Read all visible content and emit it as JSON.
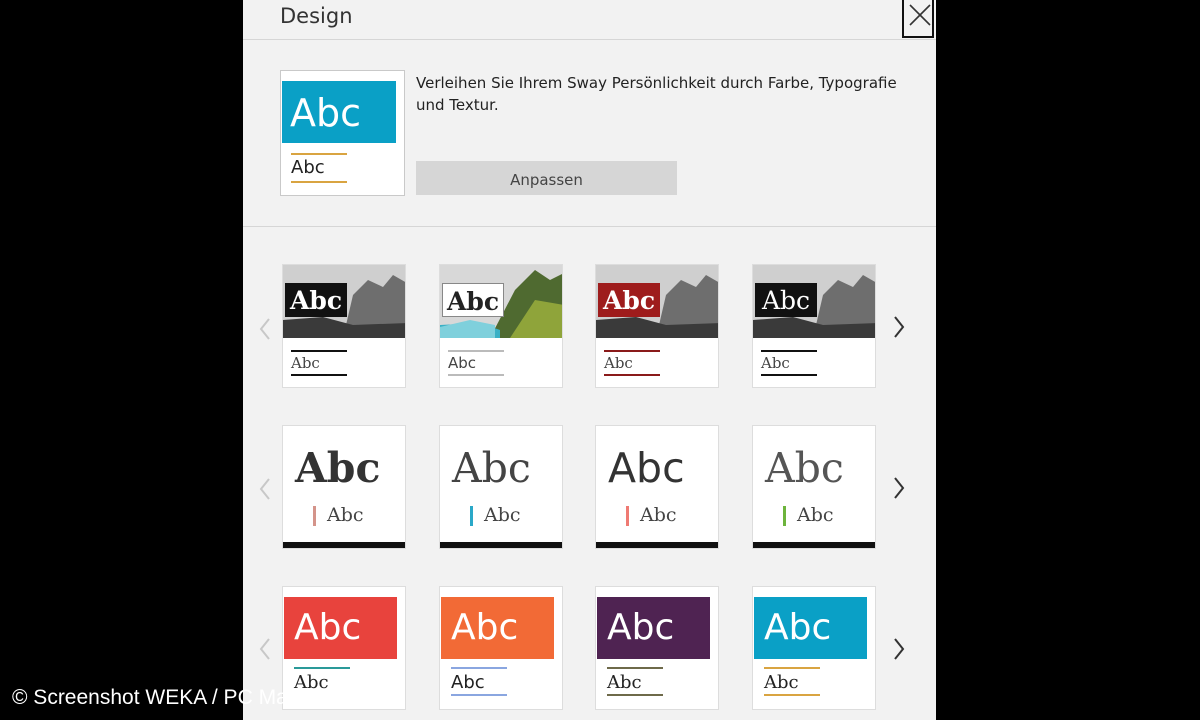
{
  "panel": {
    "title": "Design"
  },
  "current_design": {
    "thumb_big": "Abc",
    "thumb_small": "Abc",
    "description": "Verleihen Sie Ihrem Sway Persönlichkeit durch Farbe, Typografie und Textur.",
    "customize_label": "Anpassen"
  },
  "rows": [
    {
      "style": "photo",
      "cards": [
        {
          "text": "Abc",
          "small": "Abc",
          "block": "#111111",
          "accent": "#111111"
        },
        {
          "text": "Abc",
          "small": "Abc",
          "block": "#ffffff",
          "accent": "#bbbbbb"
        },
        {
          "text": "Abc",
          "small": "Abc",
          "block": "#9e1c1c",
          "accent": "#8a1a1a"
        },
        {
          "text": "Abc",
          "small": "Abc",
          "block": "#111111",
          "accent": "#111111"
        }
      ]
    },
    {
      "style": "typo",
      "cards": [
        {
          "text": "Abc",
          "small": "Abc",
          "accent": "#d4948a"
        },
        {
          "text": "Abc",
          "small": "Abc",
          "accent": "#2aa8c8"
        },
        {
          "text": "Abc",
          "small": "Abc",
          "accent": "#ef7a73"
        },
        {
          "text": "Abc",
          "small": "Abc",
          "accent": "#6db43c"
        }
      ]
    },
    {
      "style": "color",
      "cards": [
        {
          "text": "Abc",
          "small": "Abc",
          "block": "#e8433d",
          "accent": "#2a9a99"
        },
        {
          "text": "Abc",
          "small": "Abc",
          "block": "#f26a36",
          "accent": "#8aa6e0"
        },
        {
          "text": "Abc",
          "small": "Abc",
          "block": "#4f2352",
          "accent": "#6e6a4a"
        },
        {
          "text": "Abc",
          "small": "Abc",
          "block": "#0aa0c6",
          "accent": "#d9a441"
        }
      ]
    }
  ],
  "watermark": "© Screenshot WEKA / PC Magazin",
  "icons": {
    "close": "close-icon",
    "prev": "chevron-left-icon",
    "next": "chevron-right-icon"
  }
}
